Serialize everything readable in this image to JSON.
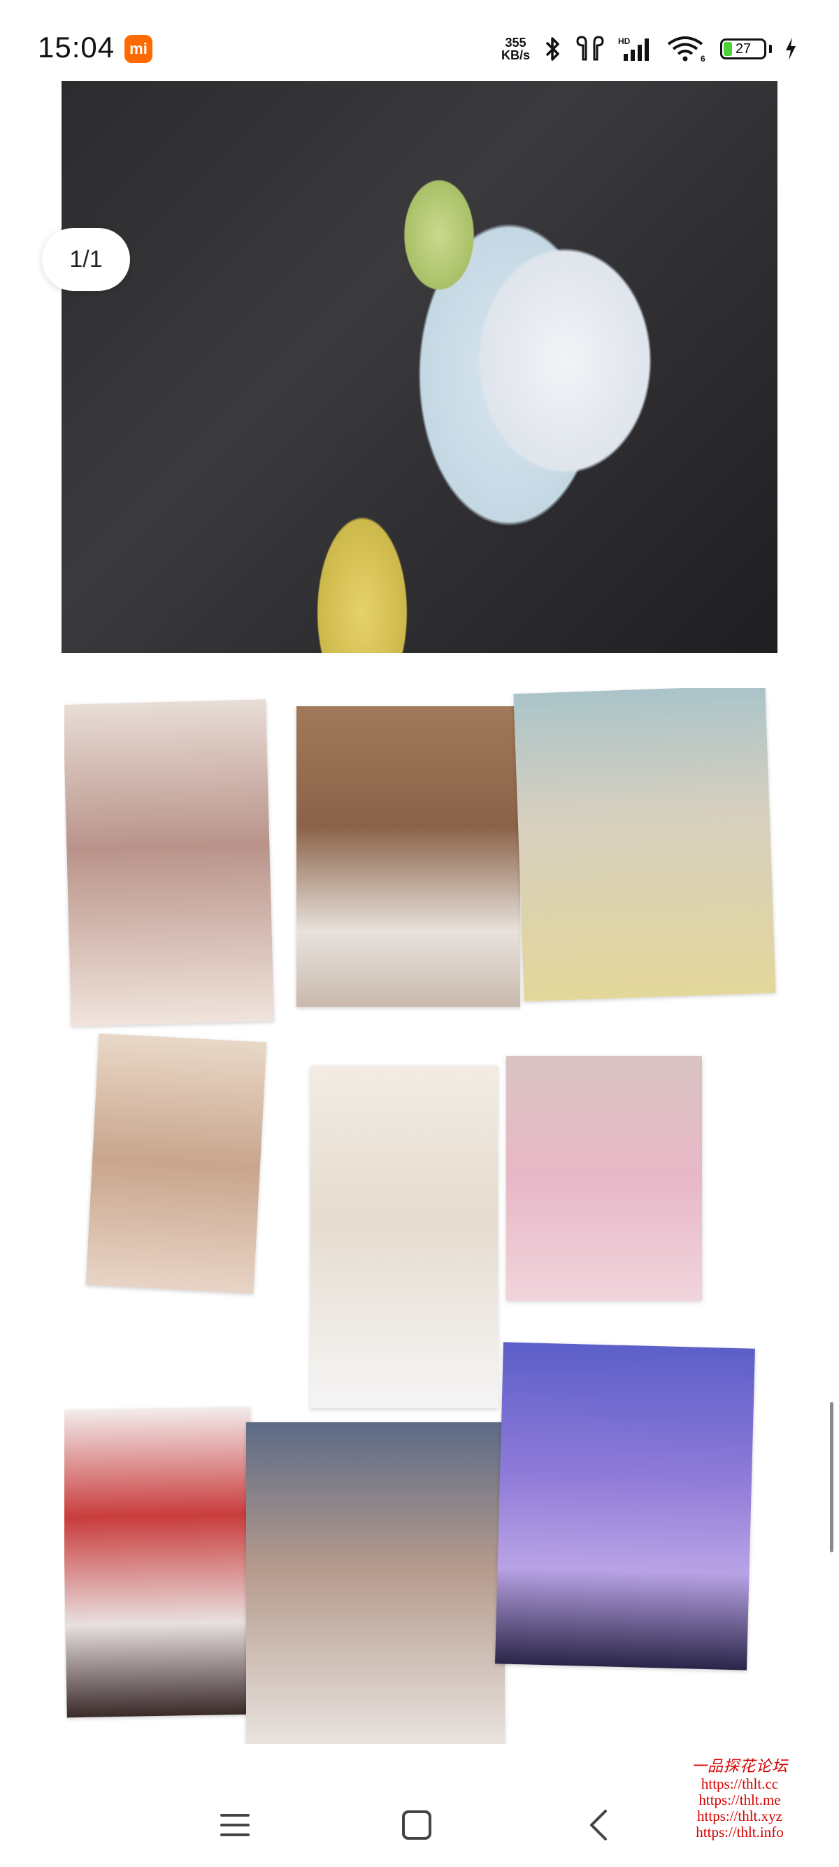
{
  "status_bar": {
    "time": "15:04",
    "app_badge": "mi",
    "net_speed_value": "355",
    "net_speed_unit": "KB/s",
    "signal_label": "HD",
    "wifi_label": "6",
    "battery_level": "27",
    "battery_fraction": 0.27
  },
  "viewer": {
    "page_counter": "1/1"
  },
  "watermark": {
    "title": "一品探花论坛",
    "links": [
      "https://thlt.cc",
      "https://thlt.me",
      "https://thlt.xyz",
      "https://thlt.info"
    ]
  },
  "colors": {
    "badge": "#ff6a00",
    "battery_fill": "#4cd137",
    "watermark": "#d80000"
  },
  "icons": {
    "bluetooth": "bluetooth-icon",
    "earbuds": "earbuds-icon",
    "signal": "cellular-signal-icon",
    "wifi": "wifi-icon",
    "charging": "charging-bolt-icon",
    "menu": "menu-icon",
    "home": "home-icon",
    "back": "back-icon"
  }
}
